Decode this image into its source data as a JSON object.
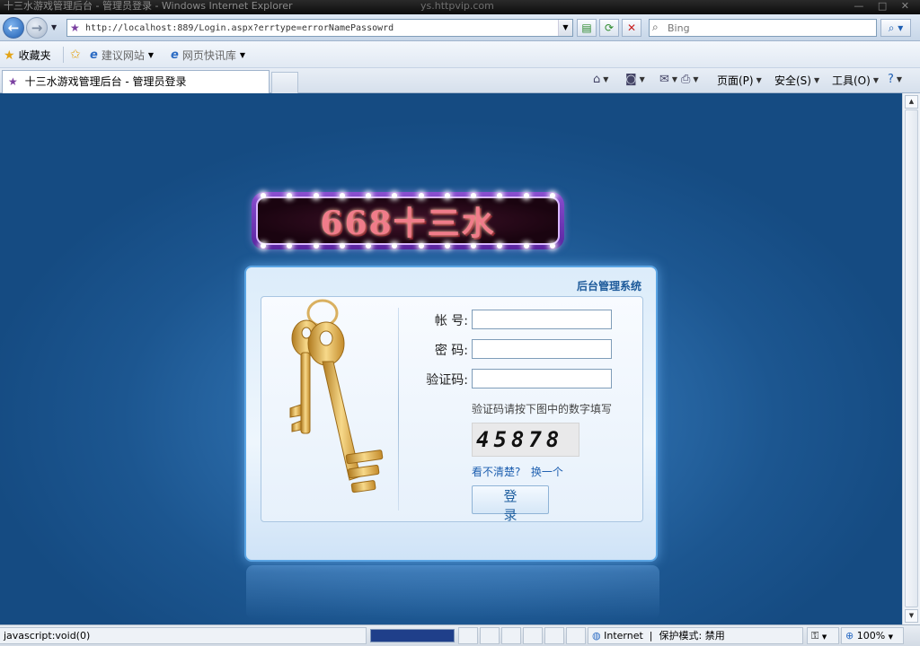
{
  "window": {
    "title": "十三水游戏管理后台 - 管理员登录 - Windows Internet Explorer",
    "watermark": "ys.httpvip.com",
    "controls": "— □ ✕"
  },
  "address_bar": {
    "url": "http://localhost:889/Login.aspx?errtype=errorNamePassowrd",
    "search_placeholder": "Bing"
  },
  "favorites_bar": {
    "favorites_label": "收藏夹",
    "items": [
      {
        "label": "建议网站"
      },
      {
        "label": "网页快讯库"
      }
    ]
  },
  "tab": {
    "title": "十三水游戏管理后台 - 管理员登录"
  },
  "command_bar": {
    "page": "页面(P)",
    "safety": "安全(S)",
    "tools": "工具(O)"
  },
  "logo": {
    "text": "668十三水"
  },
  "login": {
    "panel_title": "后台管理系统",
    "account_label": "帐 号:",
    "password_label": "密 码:",
    "captcha_label": "验证码:",
    "account_value": "",
    "password_value": "",
    "captcha_value": "",
    "captcha_hint": "验证码请按下图中的数字填写",
    "captcha_image_text": "45878",
    "cant_see": "看不清楚?",
    "refresh": "换一个",
    "submit": "登 录"
  },
  "status_bar": {
    "left_text": "javascript:void(0)",
    "zone": "Internet",
    "protected_mode": "保护模式: 禁用",
    "zoom": "100%"
  },
  "colors": {
    "page_background": "#1a4f84",
    "panel_border": "#5aa4e3",
    "logo_purple": "#6a30b8",
    "link_blue": "#1f60b0"
  }
}
